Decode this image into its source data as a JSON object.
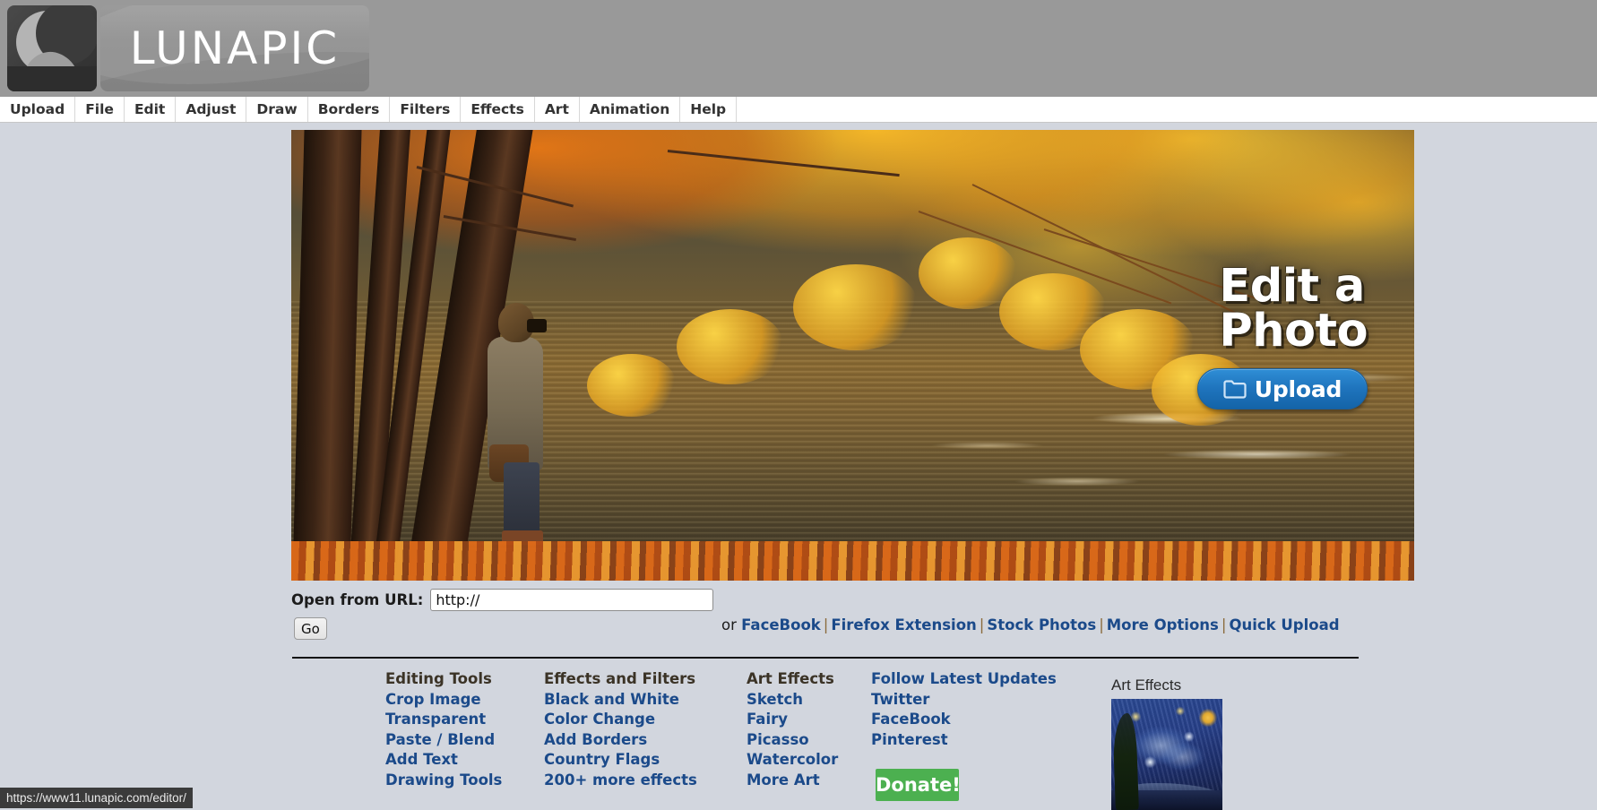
{
  "header": {
    "logo_text": "LUNAPIC",
    "logo_icon": "crescent-moon-icon",
    "background_color": "#999999"
  },
  "menubar": {
    "items": [
      {
        "label": "Upload"
      },
      {
        "label": "File"
      },
      {
        "label": "Edit"
      },
      {
        "label": "Adjust"
      },
      {
        "label": "Draw"
      },
      {
        "label": "Borders"
      },
      {
        "label": "Filters"
      },
      {
        "label": "Effects"
      },
      {
        "label": "Art"
      },
      {
        "label": "Animation"
      },
      {
        "label": "Help"
      }
    ]
  },
  "hero": {
    "title": "Edit a\nPhoto",
    "upload_button_label": "Upload",
    "upload_button_icon": "folder-icon",
    "upload_button_color": "#1f74bd",
    "photo_description": "Autumn photographer by a lake with golden foliage"
  },
  "url_form": {
    "label": "Open from URL:",
    "input_value": "http://",
    "input_placeholder": "http://",
    "go_label": "Go"
  },
  "alt_sources": {
    "prefix": "or",
    "separator": "|",
    "links": [
      {
        "label": "FaceBook"
      },
      {
        "label": "Firefox Extension"
      },
      {
        "label": "Stock Photos"
      },
      {
        "label": "More Options"
      },
      {
        "label": "Quick Upload"
      }
    ]
  },
  "footer": {
    "columns": [
      {
        "heading": "Editing Tools",
        "heading_is_link": false,
        "links": [
          {
            "label": "Crop Image"
          },
          {
            "label": "Transparent"
          },
          {
            "label": "Paste / Blend"
          },
          {
            "label": "Add Text"
          },
          {
            "label": "Drawing Tools"
          }
        ]
      },
      {
        "heading": "Effects and Filters",
        "heading_is_link": false,
        "links": [
          {
            "label": "Black and White"
          },
          {
            "label": "Color Change"
          },
          {
            "label": "Add Borders"
          },
          {
            "label": "Country Flags"
          },
          {
            "label": "200+ more effects"
          }
        ]
      },
      {
        "heading": "Art Effects",
        "heading_is_link": false,
        "links": [
          {
            "label": "Sketch"
          },
          {
            "label": "Fairy"
          },
          {
            "label": "Picasso"
          },
          {
            "label": "Watercolor"
          },
          {
            "label": "More Art"
          }
        ]
      },
      {
        "heading": "Follow Latest Updates",
        "heading_is_link": true,
        "links": [
          {
            "label": "Twitter"
          },
          {
            "label": "FaceBook"
          },
          {
            "label": "Pinterest"
          }
        ]
      }
    ],
    "donate_label": "Donate!",
    "donate_color": "#4cb050"
  },
  "art_preview": {
    "label": "Art Effects",
    "thumbnail_description": "starry-night-painting"
  },
  "statusbar": {
    "url": "https://www11.lunapic.com/editor/"
  }
}
